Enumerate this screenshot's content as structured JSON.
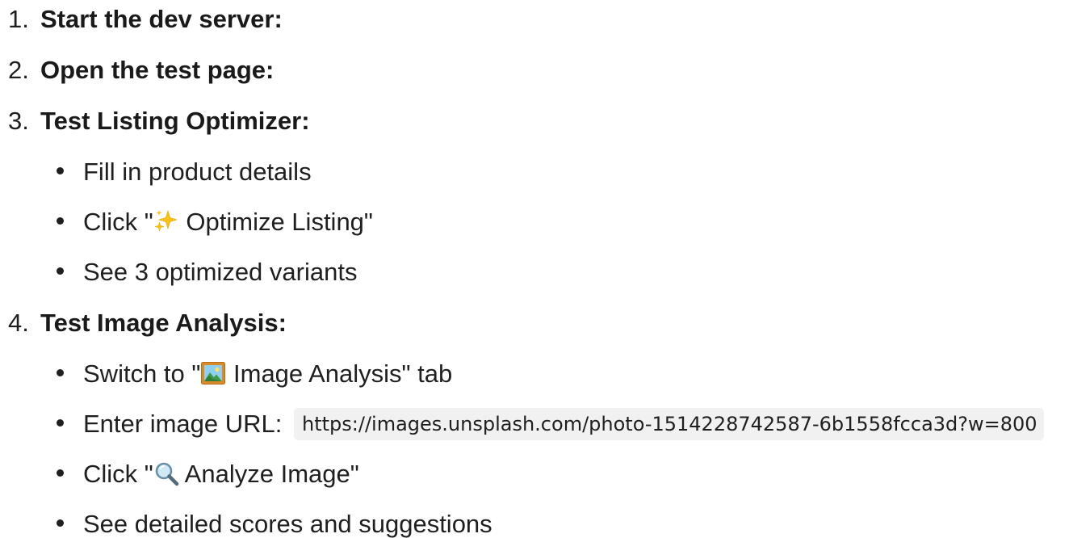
{
  "steps": [
    {
      "number": "1.",
      "title": "Start the dev server:"
    },
    {
      "number": "2.",
      "title": "Open the test page:"
    },
    {
      "number": "3.",
      "title": "Test Listing Optimizer:",
      "bullets": [
        {
          "text": "Fill in product details"
        },
        {
          "before": "Click \"",
          "icon": "sparkles-icon",
          "after": " Optimize Listing\""
        },
        {
          "text": "See 3 optimized variants"
        }
      ]
    },
    {
      "number": "4.",
      "title": "Test Image Analysis:",
      "bullets": [
        {
          "before": "Switch to \"",
          "icon": "framed-picture-icon",
          "after": " Image Analysis\" tab"
        },
        {
          "before": "Enter image URL:",
          "code": "https://images.unsplash.com/photo-1514228742587-6b1558fcca3d?w=800"
        },
        {
          "before": "Click \"",
          "icon": "magnifying-glass-icon",
          "after": " Analyze Image\""
        },
        {
          "text": "See detailed scores and suggestions"
        }
      ]
    }
  ],
  "colors": {
    "text": "#1f1f1f",
    "code_background": "#f1f1f1"
  }
}
